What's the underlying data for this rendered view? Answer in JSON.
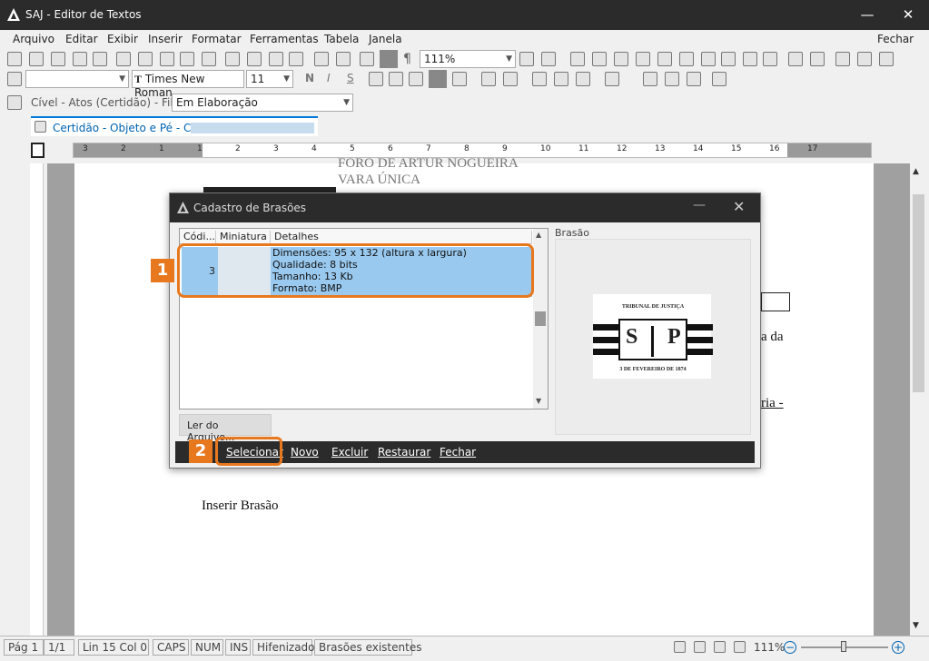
{
  "window": {
    "title": "SAJ - Editor de Textos"
  },
  "menu": {
    "items": [
      "Arquivo",
      "Editar",
      "Exibir",
      "Inserir",
      "Formatar",
      "Ferramentas",
      "Tabela",
      "Janela"
    ],
    "close": "Fechar"
  },
  "toolbar": {
    "zoom": "111%",
    "font": "Times New Roman",
    "size": "11",
    "bold": "N",
    "italic": "I",
    "underline": "S"
  },
  "context": {
    "label": "Cível - Atos (Certidão) - Fila:",
    "queue": "Em Elaboração"
  },
  "doc_tab": {
    "label": "Certidão - Objeto e Pé - Cível"
  },
  "ruler": {
    "numbers": [
      "3",
      "2",
      "1",
      "1",
      "2",
      "3",
      "4",
      "5",
      "6",
      "7",
      "8",
      "9",
      "10",
      "11",
      "12",
      "13",
      "14",
      "15",
      "16",
      "17"
    ]
  },
  "document": {
    "header_line1": "FORO DE ARTUR NOGUEIRA",
    "header_line2": "VARA ÚNICA",
    "text_da": "a da",
    "text_ria": "ria -",
    "insert_label": "Inserir Brasão"
  },
  "dialog": {
    "title": "Cadastro de Brasões",
    "columns": [
      "Códi...",
      "Miniatura",
      "Detalhes"
    ],
    "rows": [
      {
        "code": "3",
        "details": [
          "Dimensões: 95 x 132 (altura x largura)",
          "Qualidade: 8 bits",
          "Tamanho: 13 Kb",
          "Formato: BMP"
        ]
      }
    ],
    "read_file": "Ler do Arquivo...",
    "preview_label": "Brasão",
    "buttons": [
      "Selecionar",
      "Novo",
      "Excluir",
      "Restaurar",
      "Fechar"
    ],
    "crest": {
      "top": "TRIBUNAL DE JUSTIÇA",
      "bottom": "3 DE FEVEREIRO DE 1874",
      "s": "S",
      "p": "P"
    }
  },
  "callouts": [
    "1",
    "2"
  ],
  "status": {
    "page": "Pág 1",
    "pages": "1/1",
    "line": "Lin 15  Col 0",
    "caps": "CAPS",
    "num": "NUM",
    "ins": "INS",
    "hyphen": "Hifenizado",
    "crests": "Brasões existentes",
    "zoom": "111%"
  },
  "colors": {
    "accent": "#e8781e",
    "selection": "#99c9ef",
    "titlebar": "#2b2b2b"
  }
}
